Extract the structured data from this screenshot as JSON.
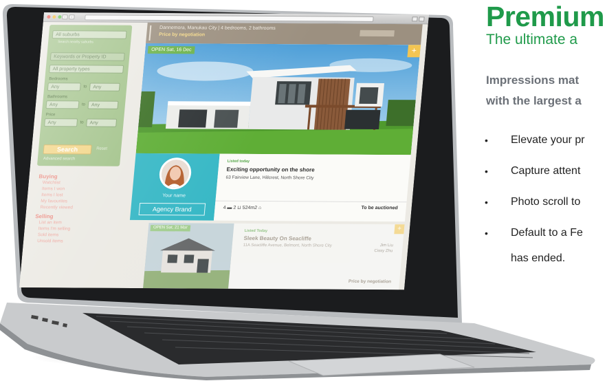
{
  "promo": {
    "title": "Premium",
    "subtitle": "The ultimate a",
    "lead_line1": "Impressions mat",
    "lead_line2": "with the largest a",
    "bullets": [
      "Elevate your pr",
      "Capture attent",
      "Photo scroll to",
      "Default to a Fe"
    ],
    "bullet4_cont": "has ended."
  },
  "colors": {
    "brand_green": "#1f9a4a",
    "sidebar_green": "#a4c48c",
    "agent_teal": "#38b8c6",
    "search_yellow": "#f3d688",
    "menu_pink": "#ec8e84"
  },
  "sidebar": {
    "region_select": "All suburbs",
    "region_hint": "Search nearby suburbs",
    "keyword_placeholder": "Keywords or Property ID",
    "property_type": "All property types",
    "bedrooms_label": "Bedrooms",
    "bathrooms_label": "Bathrooms",
    "price_label": "Price",
    "any": "Any",
    "to": "to",
    "search_label": "Search",
    "reset_label": "Reset",
    "advanced_label": "Advanced search"
  },
  "menu": {
    "buying_title": "Buying",
    "buying_items": [
      "Watchlist",
      "Items I won",
      "Items I lost",
      "My favourites",
      "Recently viewed"
    ],
    "selling_title": "Selling",
    "selling_items": [
      "List an item",
      "Items I'm selling",
      "Sold items",
      "Unsold items"
    ]
  },
  "listing_header": {
    "location": "Dannemora, Manukau City | 4 bedrooms, 2 bathrooms",
    "price": "Price by negotiation"
  },
  "main_listing": {
    "open_home": "OPEN  Sat, 16 Dec",
    "corner_icon": "plus-icon",
    "agent_name": "Your name",
    "agency_brand": "Agency Brand",
    "listed": "Listed today",
    "title": "Exciting opportunity on the shore",
    "address": "63 Fairview Lane, Hillcrest, North Shore City",
    "features": "4 ▬  2 ⊔  524m2 ⌂",
    "sale_method": "To be auctioned"
  },
  "second_listing": {
    "open_home": "OPEN  Sat, 21 Mar",
    "listed": "Listed Today",
    "title": "Sleek Beauty On Seacliffe",
    "address": "11A Seacliffe Avenue, Belmont, North Shore City",
    "agent1": "Jim Liu",
    "agent2": "Cissy Zhu",
    "price": "Price by negotiation"
  }
}
